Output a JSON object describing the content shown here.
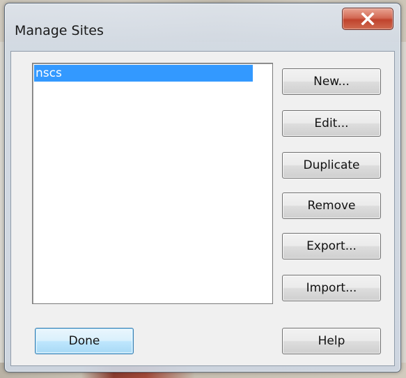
{
  "window": {
    "title": "Manage Sites",
    "close_icon": "close-x-icon"
  },
  "sites_list": {
    "items": [
      "nscs"
    ],
    "selected_index": 0
  },
  "buttons": {
    "new": "New...",
    "edit": "Edit...",
    "duplicate": "Duplicate",
    "remove": "Remove",
    "export": "Export...",
    "import": "Import...",
    "done": "Done",
    "help": "Help"
  },
  "colors": {
    "selection": "#3399ff",
    "close_button": "#c0432d"
  }
}
